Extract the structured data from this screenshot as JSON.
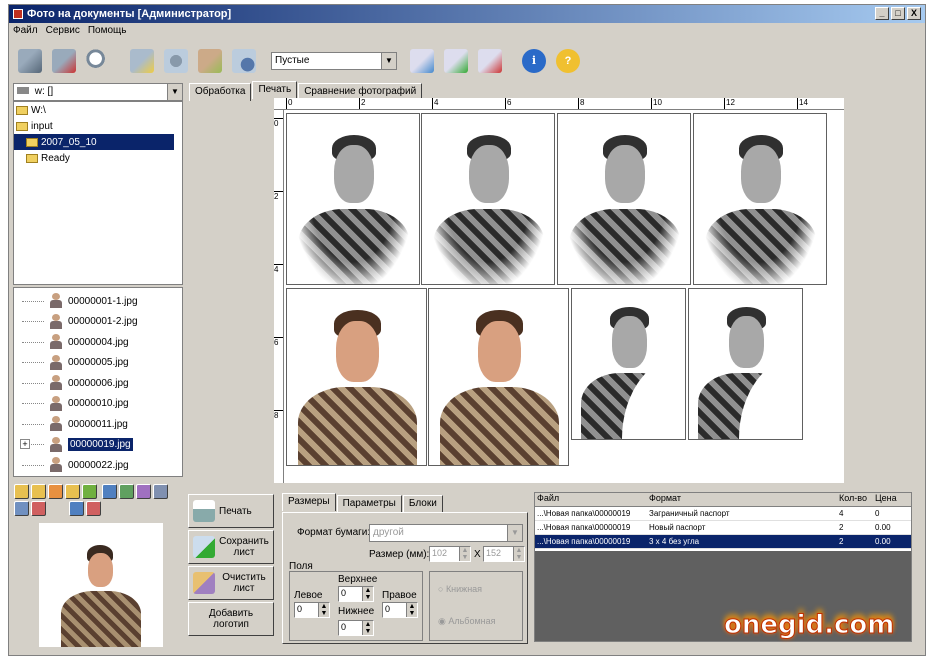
{
  "window": {
    "title": "Фото на документы [Администратор]",
    "min": "_",
    "max": "□",
    "close": "X"
  },
  "menu": [
    "Файл",
    "Сервис",
    "Помощь"
  ],
  "toolbar": {
    "combo_value": "Пустые"
  },
  "drive": {
    "value": "w: []"
  },
  "folders": [
    {
      "label": "W:\\",
      "indent": 0,
      "selected": false
    },
    {
      "label": "input",
      "indent": 0,
      "selected": false
    },
    {
      "label": "2007_05_10",
      "indent": 1,
      "selected": true
    },
    {
      "label": "Ready",
      "indent": 1,
      "selected": false
    }
  ],
  "files": [
    {
      "name": "00000001-1.jpg",
      "selected": false
    },
    {
      "name": "00000001-2.jpg",
      "selected": false
    },
    {
      "name": "00000004.jpg",
      "selected": false
    },
    {
      "name": "00000005.jpg",
      "selected": false
    },
    {
      "name": "00000006.jpg",
      "selected": false
    },
    {
      "name": "00000010.jpg",
      "selected": false
    },
    {
      "name": "00000011.jpg",
      "selected": false
    },
    {
      "name": "00000019.jpg",
      "selected": true
    },
    {
      "name": "00000022.jpg",
      "selected": false
    }
  ],
  "main_tabs": [
    "Обработка",
    "Печать",
    "Сравнение фотографий"
  ],
  "active_main_tab": "Печать",
  "ruler_h": [
    "0",
    "2",
    "4",
    "6",
    "8",
    "10",
    "12",
    "14"
  ],
  "ruler_v": [
    "0",
    "2",
    "4",
    "6",
    "8"
  ],
  "actions": {
    "print": "Печать",
    "save": "Сохранить лист",
    "clear": "Очистить лист",
    "add_logo": "Добавить логотип"
  },
  "settings_tabs": [
    "Размеры",
    "Параметры",
    "Блоки"
  ],
  "settings": {
    "paper_format_label": "Формат бумаги:",
    "paper_format_value": "другой",
    "size_label": "Размер (мм):",
    "width": "102",
    "x_sep": "X",
    "height": "152",
    "margins_label": "Поля",
    "top_label": "Верхнее",
    "left_label": "Левое",
    "right_label": "Правое",
    "bottom_label": "Нижнее",
    "top": "0",
    "left": "0",
    "right": "0",
    "bottom": "0",
    "portrait": "Книжная",
    "landscape": "Альбомная"
  },
  "grid": {
    "headers": [
      "Файл",
      "Формат",
      "Кол-во",
      "Цена"
    ],
    "rows": [
      {
        "file": "...\\Новая папка\\00000019",
        "format": "Заграничный паспорт",
        "qty": "4",
        "price": "0",
        "selected": false
      },
      {
        "file": "...\\Новая папка\\00000019",
        "format": "Новый паспорт",
        "qty": "2",
        "price": "0.00",
        "selected": false
      },
      {
        "file": "...\\Новая папка\\00000019",
        "format": "3 x 4 без угла",
        "qty": "2",
        "price": "0.00",
        "selected": true
      }
    ]
  },
  "watermark": "onegid.com",
  "colors": {
    "accent": "#0a246a",
    "face": "#d4d0c8"
  }
}
